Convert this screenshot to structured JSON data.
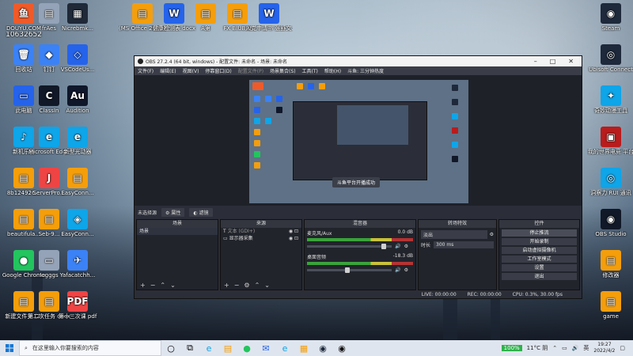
{
  "desktop": {
    "icons_left": [
      {
        "label": "DOUYU.COM",
        "sub": "10632652",
        "color": "#f05a28",
        "glyph": "鱼"
      },
      {
        "label": "回收站",
        "color": "#3b82f6",
        "glyph": "🗑"
      },
      {
        "label": "此电脑",
        "color": "#2563eb",
        "glyph": "▭"
      },
      {
        "label": "新机乐器",
        "color": "#0ea5e9",
        "glyph": "♪"
      },
      {
        "label": "8b124926...",
        "color": "#f59e0b",
        "glyph": "▤"
      },
      {
        "label": "beautifula...",
        "color": "#f59e0b",
        "glyph": "▤"
      },
      {
        "label": "Google Chrome",
        "color": "#22c55e",
        "glyph": "●"
      },
      {
        "label": "新建文件夹 (2)",
        "color": "#f59e0b",
        "glyph": "▤"
      }
    ],
    "icons_col2": [
      {
        "label": "frAes",
        "color": "#94a3b8",
        "glyph": "▤"
      },
      {
        "label": "钉钉",
        "color": "#3b82f6",
        "glyph": "◆"
      },
      {
        "label": "ClassIn",
        "color": "#111827",
        "glyph": "C"
      },
      {
        "label": "Microsoft Edge",
        "color": "#0ea5e9",
        "glyph": "e"
      },
      {
        "label": "ServerPro...",
        "color": "#ef4444",
        "glyph": "J"
      },
      {
        "label": "Seb-9...",
        "color": "#f59e0b",
        "glyph": "▤"
      },
      {
        "label": "Iogggs",
        "color": "#94a3b8",
        "glyph": "▭"
      },
      {
        "label": "第二次任务 docx",
        "color": "#f59e0b",
        "glyph": "▤"
      }
    ],
    "icons_col3": [
      {
        "label": "Nicrebmk...",
        "color": "#1f2937",
        "glyph": "▦"
      },
      {
        "label": "VSCodeUs...",
        "color": "#2563eb",
        "glyph": "◇"
      },
      {
        "label": "Audition",
        "color": "#0f172a",
        "glyph": "Au"
      },
      {
        "label": "新型光动器",
        "color": "#0ea5e9",
        "glyph": "e"
      },
      {
        "label": "EasyConn...",
        "color": "#f59e0b",
        "glyph": "▤"
      },
      {
        "label": "EasyConn...",
        "color": "#0ea5e9",
        "glyph": "◈"
      },
      {
        "label": "Yafacatchh...",
        "color": "#3b82f6",
        "glyph": "✈"
      },
      {
        "label": "第十三次课 pdf",
        "color": "#ef4444",
        "glyph": "PDF"
      }
    ],
    "icons_top": [
      {
        "label": "(MS Office 2021最1...",
        "color": "#f59e0b",
        "glyph": "▤"
      },
      {
        "label": "健康检测表 docx",
        "color": "#2563eb",
        "glyph": "W"
      },
      {
        "label": "A第",
        "color": "#f59e0b",
        "glyph": "▤"
      },
      {
        "label": "FX BIUBIU",
        "color": "#f59e0b",
        "glyph": "▤"
      },
      {
        "label": "入党申请书 张舒文.docx",
        "color": "#2563eb",
        "glyph": "W"
      }
    ],
    "icons_right": [
      {
        "label": "Steam",
        "color": "#1e293b",
        "glyph": "◉"
      },
      {
        "label": "Ubisoft Connect",
        "color": "#1e293b",
        "glyph": "◎"
      },
      {
        "label": "奇妙动漫工具",
        "color": "#0ea5e9",
        "glyph": "✦"
      },
      {
        "label": "我的世界电竞 平台",
        "color": "#b91c1c",
        "glyph": "▣"
      },
      {
        "label": "洞察力 RUI 通讯",
        "color": "#0ea5e9",
        "glyph": "◎"
      },
      {
        "label": "OBS Studio",
        "color": "#111827",
        "glyph": "◉"
      },
      {
        "label": "修改器",
        "color": "#f59e0b",
        "glyph": "▤"
      },
      {
        "label": "game",
        "color": "#f59e0b",
        "glyph": "▤"
      }
    ]
  },
  "obs": {
    "title": "OBS 27.2.4 (64 bit, windows) - 配置文件: 未命名 - 场景: 未命名",
    "menu": [
      "文件(F)",
      "编辑(E)",
      "视图(V)",
      "停靠窗口(D)",
      "配置文件(P)",
      "场景集合(S)",
      "工具(T)",
      "帮助(H)",
      "斗鱼: 三分钟热度"
    ],
    "preview_toast": "斗鱼平台开播成功",
    "source_bar": {
      "label": "未选择源",
      "properties": "属性",
      "filters": "滤镜"
    },
    "docks": {
      "scenes": {
        "header": "场景",
        "items": [
          "场景"
        ]
      },
      "sources": {
        "header": "来源",
        "items": [
          "文本 (GDI+)",
          "显示器采集"
        ]
      },
      "mixer": {
        "header": "混音器",
        "channels": [
          {
            "name": "麦克风/Aux",
            "db": "0.0 dB"
          },
          {
            "name": "桌面音频",
            "db": "-18.3 dB"
          }
        ]
      },
      "transitions": {
        "header": "转场特效",
        "type": "淡出",
        "duration_label": "时长",
        "duration_value": "300 ms"
      },
      "controls": {
        "header": "控件",
        "buttons": [
          "停止推流",
          "开始录制",
          "启动虚拟摄像机",
          "工作室模式",
          "设置",
          "退出"
        ]
      }
    },
    "status": {
      "live": "LIVE: 00:00:00",
      "rec": "REC: 00:00:00",
      "cpu": "CPU: 0.3%, 30.00 fps"
    }
  },
  "taskbar": {
    "search_placeholder": "在这里输入你要搜索的内容",
    "weather": "11°C 阴",
    "time": "19:27",
    "date": "2022/4/2",
    "battery": "100%",
    "lang": "英"
  }
}
